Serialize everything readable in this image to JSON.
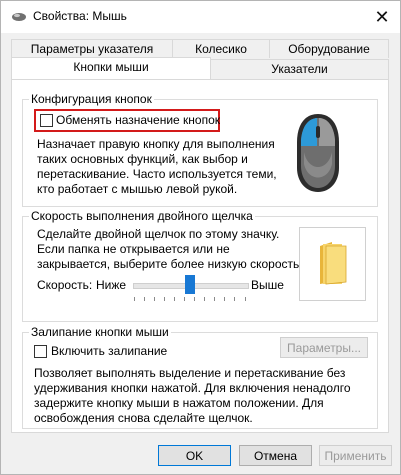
{
  "window": {
    "title": "Свойства: Мышь",
    "close_glyph": "✕"
  },
  "tabs": {
    "row1": [
      "Параметры указателя",
      "Колесико",
      "Оборудование"
    ],
    "row2": [
      "Кнопки мыши",
      "Указатели"
    ],
    "active": "Кнопки мыши"
  },
  "button_config": {
    "group_label": "Конфигурация кнопок",
    "swap_checkbox_label": "Обменять назначение кнопок",
    "swap_checked": false,
    "description_lines": [
      "Назначает правую кнопку для выполнения",
      "таких основных функций, как выбор и",
      "перетаскивание. Часто используется теми,",
      "кто работает с мышью левой рукой."
    ]
  },
  "double_click": {
    "group_label": "Скорость выполнения двойного щелчка",
    "description_lines": [
      "Сделайте двойной щелчок по этому значку.",
      "Если папка не открывается или не",
      "закрывается, выберите более низкую скорость."
    ],
    "speed_label": "Скорость:",
    "slow_label": "Ниже",
    "fast_label": "Выше",
    "speed_value_percent": 50
  },
  "click_lock": {
    "group_label": "Залипание кнопки мыши",
    "checkbox_label": "Включить залипание",
    "checked": false,
    "settings_button": "Параметры...",
    "description_lines": [
      "Позволяет выполнять выделение и перетаскивание без",
      "удерживания кнопки нажатой. Для включения ненадолго",
      "задержите кнопку мыши в нажатом положении. Для",
      "освобождения снова сделайте щелчок."
    ]
  },
  "footer": {
    "ok": "OK",
    "cancel": "Отмена",
    "apply": "Применить"
  },
  "colors": {
    "accent": "#1878d4",
    "highlight": "#d31a1a",
    "mouse_button": "#2d9ad8"
  }
}
